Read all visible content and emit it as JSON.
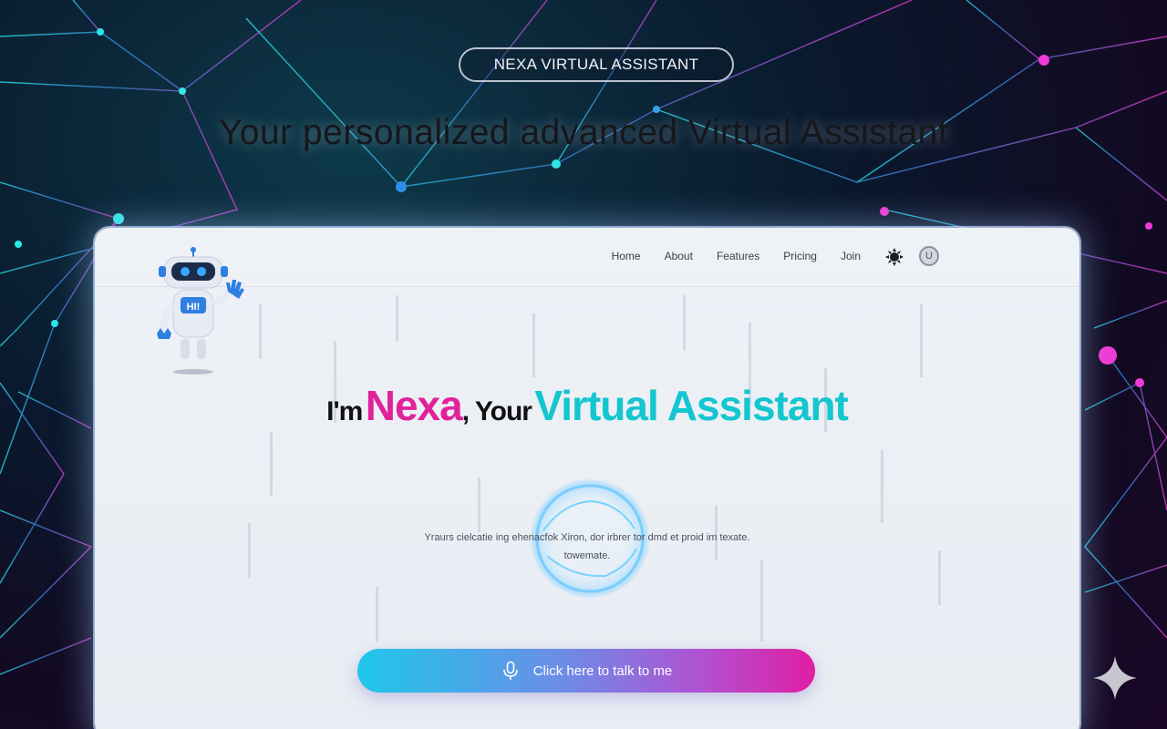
{
  "banner": {
    "badge": "NEXA VIRTUAL ASSISTANT",
    "title": "Your personalized advanced Virtual Assistant"
  },
  "app": {
    "nav": {
      "links": [
        "Home",
        "About",
        "Features",
        "Pricing",
        "Join"
      ],
      "theme_icon": "sun-icon",
      "avatar_letter": "U"
    },
    "robot": {
      "chest_text": "HI!",
      "icon": "robot-mascot-icon"
    },
    "headline": {
      "part1": "I'm",
      "part2": "Nexa",
      "part3": ", Your",
      "part4": "Virtual Assistant"
    },
    "description": {
      "line1": "Yraurs cielcatie ing ehenacfok Xiron, dor irbrer tor dmd et proid im texate.",
      "line2": "towemate."
    },
    "talk_button": {
      "label": "Click here to talk to me",
      "icon": "microphone-icon"
    }
  },
  "colors": {
    "accent_pink": "#e0239a",
    "accent_cyan": "#13c6cf",
    "button_gradient_start": "#1ec8ea",
    "button_gradient_end": "#e11ea3"
  },
  "corner_icon": "sparkle-icon"
}
